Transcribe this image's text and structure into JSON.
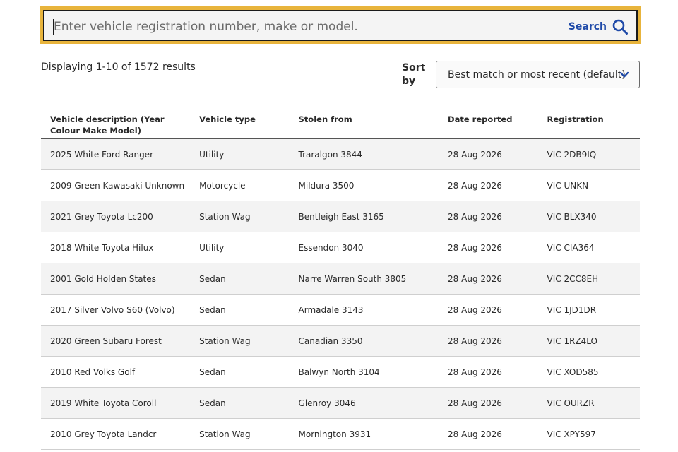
{
  "search": {
    "placeholder": "Enter vehicle registration number, make or model.",
    "value": "",
    "button_label": "Search",
    "icon": "search-icon"
  },
  "results": {
    "summary": "Displaying 1-10 of 1572 results"
  },
  "sort": {
    "label": "Sort by",
    "selected": "Best match or most recent (default)",
    "icon": "chevron-down-icon"
  },
  "table": {
    "headers": [
      "Vehicle description (Year Colour Make Model)",
      "Vehicle type",
      "Stolen from",
      "Date reported",
      "Registration"
    ],
    "rows": [
      [
        "2025 White Ford Ranger",
        "Utility",
        "Traralgon 3844",
        "28 Aug 2026",
        "VIC 2DB9IQ"
      ],
      [
        "2009 Green Kawasaki Unknown",
        "Motorcycle",
        "Mildura 3500",
        "28 Aug 2026",
        "VIC UNKN"
      ],
      [
        "2021 Grey Toyota Lc200",
        "Station Wag",
        "Bentleigh East 3165",
        "28 Aug 2026",
        "VIC BLX340"
      ],
      [
        "2018 White Toyota Hilux",
        "Utility",
        "Essendon 3040",
        "28 Aug 2026",
        "VIC CIA364"
      ],
      [
        "2001 Gold Holden States",
        "Sedan",
        "Narre Warren South 3805",
        "28 Aug 2026",
        "VIC 2CC8EH"
      ],
      [
        "2017 Silver Volvo S60 (Volvo)",
        "Sedan",
        "Armadale 3143",
        "28 Aug 2026",
        "VIC 1JD1DR"
      ],
      [
        "2020 Green Subaru Forest",
        "Station Wag",
        "Canadian 3350",
        "28 Aug 2026",
        "VIC 1RZ4LO"
      ],
      [
        "2010 Red Volks Golf",
        "Sedan",
        "Balwyn North 3104",
        "28 Aug 2026",
        "VIC XOD585"
      ],
      [
        "2019 White Toyota Coroll",
        "Sedan",
        "Glenroy 3046",
        "28 Aug 2026",
        "VIC OURZR"
      ],
      [
        "2010 Grey Toyota Landcr",
        "Station Wag",
        "Mornington 3931",
        "28 Aug 2026",
        "VIC XPY597"
      ]
    ]
  },
  "colors": {
    "focus_outline": "#e8b43c",
    "search_accent": "#1f4aa8",
    "row_shade": "#f3f3f3"
  }
}
